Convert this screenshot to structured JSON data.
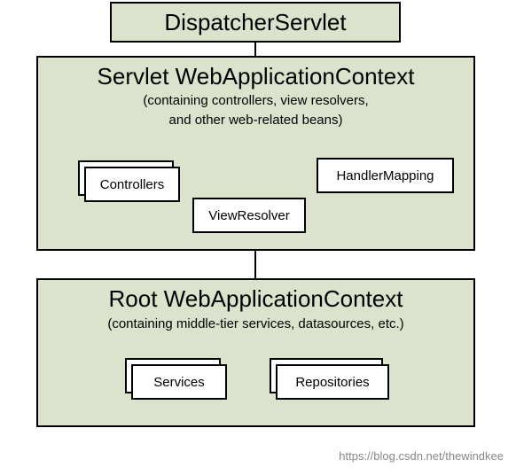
{
  "dispatcher": {
    "title": "DispatcherServlet"
  },
  "servletContext": {
    "title": "Servlet WebApplicationContext",
    "subtitle1": "(containing controllers, view resolvers,",
    "subtitle2": "and other web-related beans)",
    "controllers": "Controllers",
    "viewResolver": "ViewResolver",
    "handlerMapping": "HandlerMapping"
  },
  "rootContext": {
    "title": "Root WebApplicationContext",
    "subtitle": "(containing middle-tier services, datasources, etc.)",
    "services": "Services",
    "repositories": "Repositories"
  },
  "watermark": "https://blog.csdn.net/thewindkee"
}
